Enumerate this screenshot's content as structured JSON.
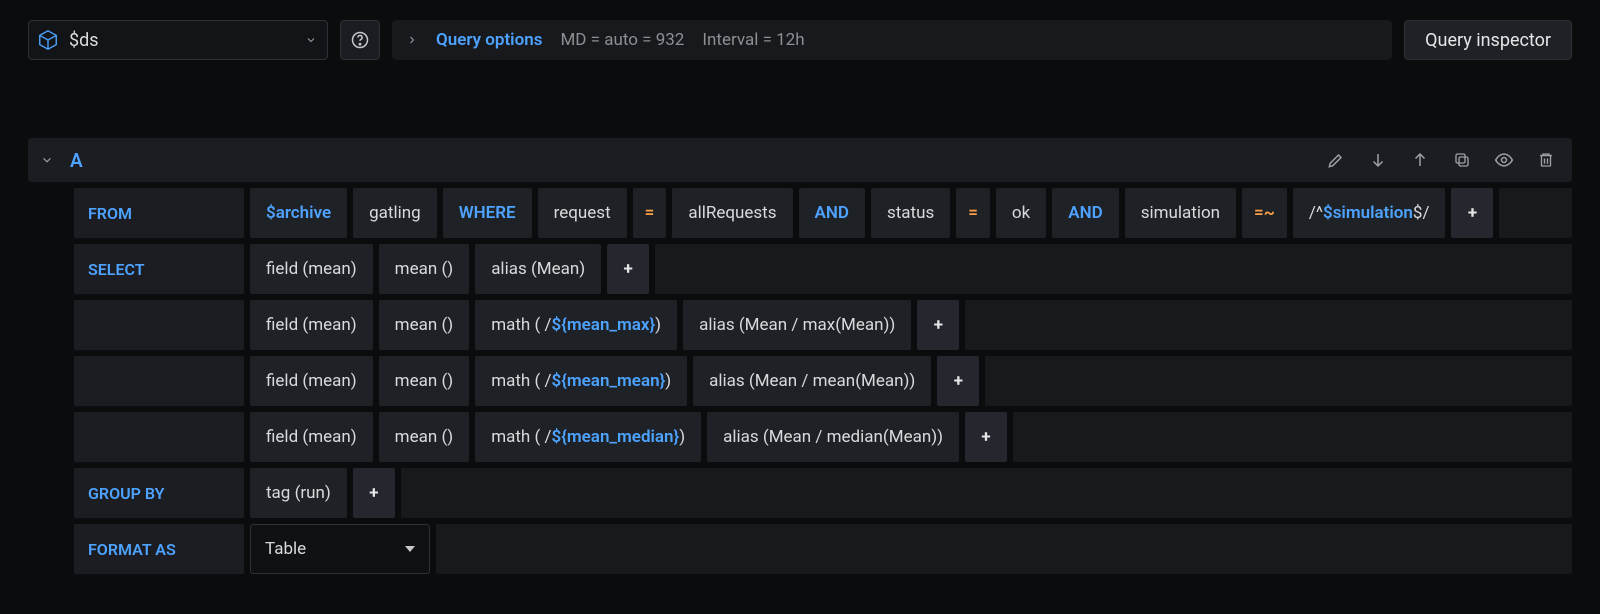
{
  "toolbar": {
    "datasource": "$ds",
    "query_options_label": "Query options",
    "md_text": "MD = auto = 932",
    "interval_text": "Interval = 12h",
    "inspector_label": "Query inspector"
  },
  "query": {
    "ref_id": "A",
    "from": {
      "keyword": "FROM",
      "policy": "$archive",
      "measurement": "gatling",
      "where_kw": "WHERE",
      "conditions": [
        {
          "key": "request",
          "op": "=",
          "value": "allRequests"
        },
        {
          "join": "AND",
          "key": "status",
          "op": "=",
          "value": "ok"
        },
        {
          "join": "AND",
          "key": "simulation",
          "op": "=~",
          "value_pre": "/^",
          "value_var": "$simulation",
          "value_post": "$/"
        }
      ]
    },
    "selects": [
      {
        "keyword": "SELECT",
        "parts": [
          {
            "text": "field (mean)"
          },
          {
            "text": "mean ()"
          },
          {
            "text": "alias (Mean)"
          }
        ]
      },
      {
        "keyword": "",
        "parts": [
          {
            "text": "field (mean)"
          },
          {
            "text": "mean ()"
          },
          {
            "math_pre": "math ( / ",
            "math_var": "${mean_max}",
            "math_post": ")"
          },
          {
            "text": "alias (Mean / max(Mean))"
          }
        ]
      },
      {
        "keyword": "",
        "parts": [
          {
            "text": "field (mean)"
          },
          {
            "text": "mean ()"
          },
          {
            "math_pre": "math ( / ",
            "math_var": "${mean_mean}",
            "math_post": ")"
          },
          {
            "text": "alias (Mean / mean(Mean))"
          }
        ]
      },
      {
        "keyword": "",
        "parts": [
          {
            "text": "field (mean)"
          },
          {
            "text": "mean ()"
          },
          {
            "math_pre": "math ( / ",
            "math_var": "${mean_median}",
            "math_post": ")"
          },
          {
            "text": "alias (Mean / median(Mean))"
          }
        ]
      }
    ],
    "group_by": {
      "keyword": "GROUP BY",
      "parts": [
        {
          "text": "tag (run)"
        }
      ]
    },
    "format_as": {
      "keyword": "FORMAT AS",
      "value": "Table"
    }
  }
}
